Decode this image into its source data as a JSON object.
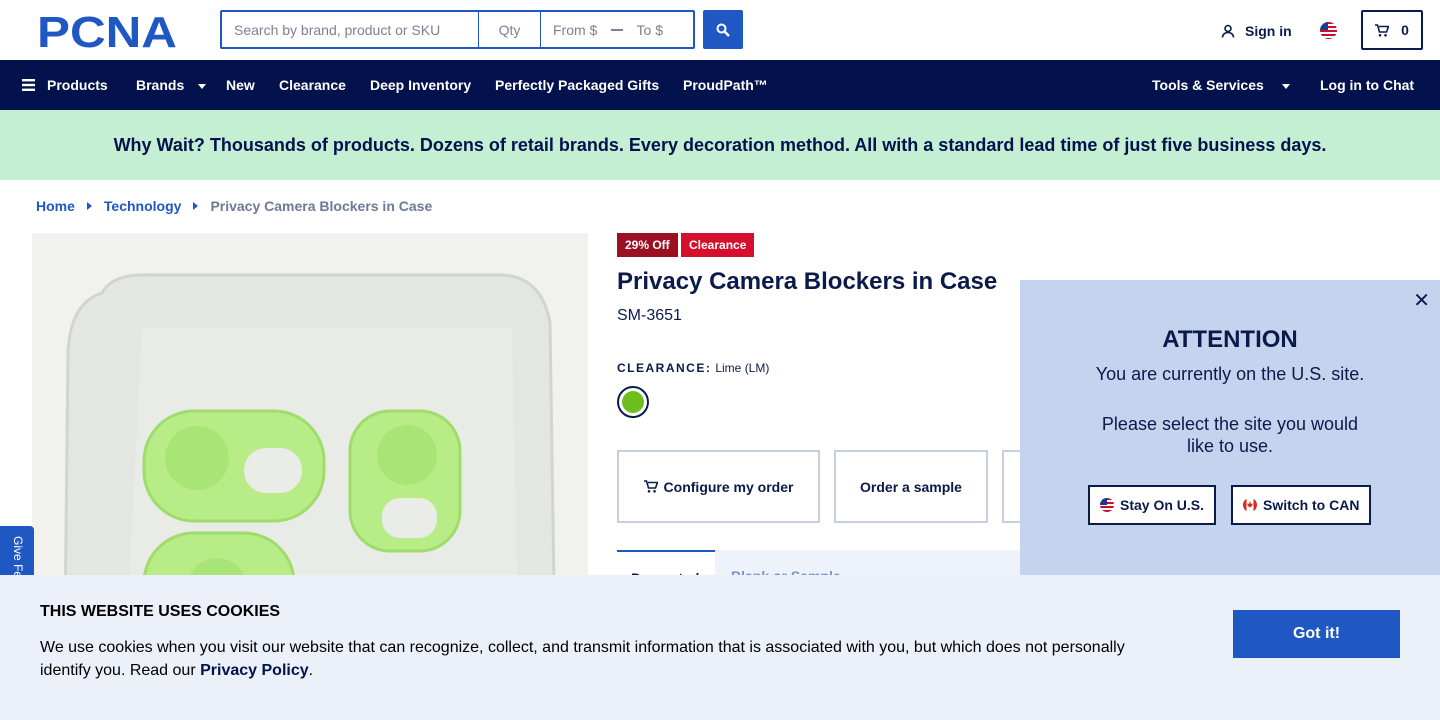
{
  "header": {
    "logo_text": "PCNA",
    "search_placeholder": "Search by brand, product or SKU",
    "qty_placeholder": "Qty",
    "from_placeholder": "From $",
    "to_placeholder": "To $",
    "sign_in": "Sign in",
    "cart_count": "0"
  },
  "nav": {
    "products": "Products",
    "brands": "Brands",
    "new": "New",
    "clearance": "Clearance",
    "deep_inventory": "Deep Inventory",
    "gifts": "Perfectly Packaged Gifts",
    "proudpath": "ProudPath™",
    "tools": "Tools & Services",
    "chat": "Log in to Chat"
  },
  "promo": "Why Wait? Thousands of products. Dozens of retail brands. Every decoration method. All with a standard lead time of just five business days.",
  "breadcrumb": [
    "Home",
    "Technology",
    "Privacy Camera Blockers in Case"
  ],
  "product": {
    "discount_badge": "29% Off",
    "clearance_badge": "Clearance",
    "title": "Privacy Camera Blockers in Case",
    "sku": "SM-3651",
    "clearance_label": "CLEARANCE:",
    "color_name": "Lime (LM)",
    "swatch_color": "#6cbf1c",
    "configure": "Configure my order",
    "sample": "Order a sample",
    "tab_active": "Decorated",
    "tab_other": "Blank or Sample"
  },
  "feedback": "Give Feedback",
  "modal": {
    "title": "ATTENTION",
    "line1": "You are currently on the U.S. site.",
    "line2": "Please select the site you would like to use.",
    "stay": "Stay On U.S.",
    "switch": "Switch to CAN"
  },
  "cookie": {
    "title": "THIS WEBSITE USES COOKIES",
    "text": "We use cookies when you visit our website that can recognize, collect, and transmit information that is associated with you, but which does not personally identify you. Read our",
    "link": "Privacy Policy",
    "end": ".",
    "button": "Got it!"
  },
  "colors": {
    "navy": "#03124d",
    "blue": "#1f57c3",
    "promo_bg": "#c5efd3",
    "modal_bg": "#c4d4ee"
  }
}
